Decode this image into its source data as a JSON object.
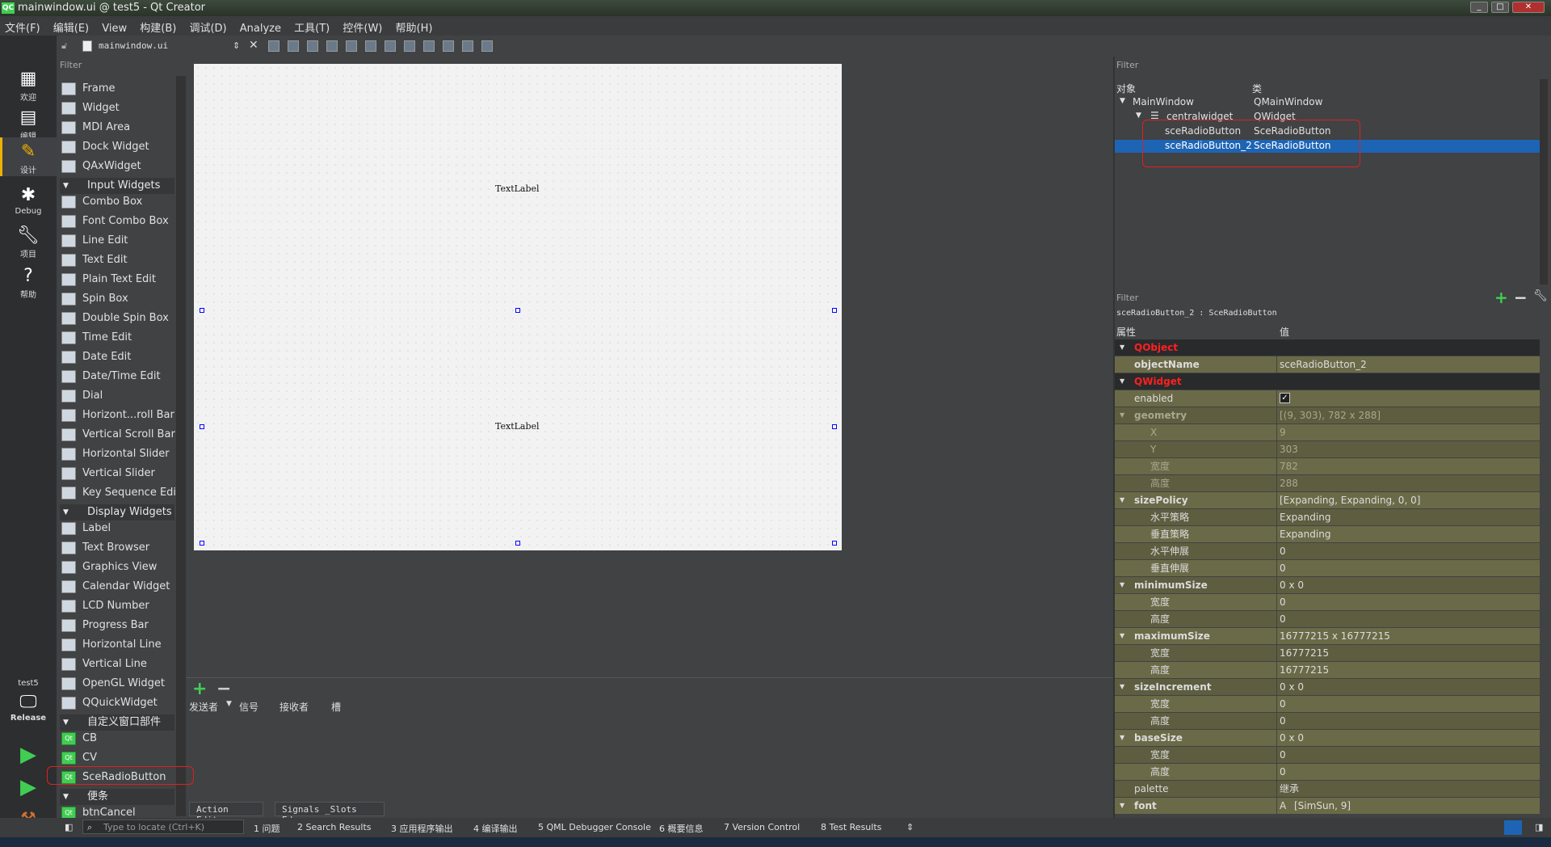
{
  "window": {
    "title": "mainwindow.ui @ test5 - Qt Creator",
    "app_badge": "QC"
  },
  "menubar": [
    "文件(F)",
    "编辑(E)",
    "View",
    "构建(B)",
    "调试(D)",
    "Analyze",
    "工具(T)",
    "控件(W)",
    "帮助(H)"
  ],
  "modes": [
    {
      "label": "欢迎",
      "icon": "grid-icon"
    },
    {
      "label": "编辑",
      "icon": "edit-doc-icon"
    },
    {
      "label": "设计",
      "icon": "pencil-icon"
    },
    {
      "label": "Debug",
      "icon": "bug-icon"
    },
    {
      "label": "项目",
      "icon": "wrench-icon"
    },
    {
      "label": "帮助",
      "icon": "help-icon"
    }
  ],
  "kit": {
    "project": "test5",
    "build": "Release"
  },
  "editor": {
    "file": "mainwindow.ui"
  },
  "widgetbox": {
    "filter": "Filter",
    "items": [
      {
        "type": "item",
        "label": "Frame"
      },
      {
        "type": "item",
        "label": "Widget"
      },
      {
        "type": "item",
        "label": "MDI Area"
      },
      {
        "type": "item",
        "label": "Dock Widget"
      },
      {
        "type": "item",
        "label": "QAxWidget"
      },
      {
        "type": "cat",
        "label": "Input Widgets"
      },
      {
        "type": "item",
        "label": "Combo Box"
      },
      {
        "type": "item",
        "label": "Font Combo Box"
      },
      {
        "type": "item",
        "label": "Line Edit"
      },
      {
        "type": "item",
        "label": "Text Edit"
      },
      {
        "type": "item",
        "label": "Plain Text Edit"
      },
      {
        "type": "item",
        "label": "Spin Box"
      },
      {
        "type": "item",
        "label": "Double Spin Box"
      },
      {
        "type": "item",
        "label": "Time Edit"
      },
      {
        "type": "item",
        "label": "Date Edit"
      },
      {
        "type": "item",
        "label": "Date/Time Edit"
      },
      {
        "type": "item",
        "label": "Dial"
      },
      {
        "type": "item",
        "label": "Horizont...roll Bar"
      },
      {
        "type": "item",
        "label": "Vertical Scroll Bar"
      },
      {
        "type": "item",
        "label": "Horizontal Slider"
      },
      {
        "type": "item",
        "label": "Vertical Slider"
      },
      {
        "type": "item",
        "label": "Key Sequence Edit"
      },
      {
        "type": "cat",
        "label": "Display Widgets"
      },
      {
        "type": "item",
        "label": "Label"
      },
      {
        "type": "item",
        "label": "Text Browser"
      },
      {
        "type": "item",
        "label": "Graphics View"
      },
      {
        "type": "item",
        "label": "Calendar Widget"
      },
      {
        "type": "item",
        "label": "LCD Number"
      },
      {
        "type": "item",
        "label": "Progress Bar"
      },
      {
        "type": "item",
        "label": "Horizontal Line"
      },
      {
        "type": "item",
        "label": "Vertical Line"
      },
      {
        "type": "item",
        "label": "OpenGL Widget"
      },
      {
        "type": "item",
        "label": "QQuickWidget"
      },
      {
        "type": "cat",
        "label": "自定义窗口部件"
      },
      {
        "type": "item",
        "label": "CB"
      },
      {
        "type": "item",
        "label": "CV"
      },
      {
        "type": "item",
        "label": "SceRadioButton"
      },
      {
        "type": "cat",
        "label": "便条"
      },
      {
        "type": "item",
        "label": "btnCancel"
      }
    ]
  },
  "canvas": {
    "label_top": "TextLabel",
    "label_bottom": "TextLabel"
  },
  "signals": {
    "headers": [
      "发送者",
      "信号",
      "接收者",
      "槽"
    ]
  },
  "bottom_tabs": [
    "Action Editor",
    "Signals _Slots Ed…"
  ],
  "object_inspector": {
    "filter": "Filter",
    "col_object": "对象",
    "col_class": "类",
    "rows": [
      {
        "name": "MainWindow",
        "cls": "QMainWindow"
      },
      {
        "name": "centralwidget",
        "cls": "QWidget"
      },
      {
        "name": "sceRadioButton",
        "cls": "SceRadioButton"
      },
      {
        "name": "sceRadioButton_2",
        "cls": "SceRadioButton"
      }
    ]
  },
  "property_editor": {
    "filter": "Filter",
    "object_line": "sceRadioButton_2 : SceRadioButton",
    "col_prop": "属性",
    "col_value": "值",
    "rows": [
      {
        "k": "QObject",
        "v": "",
        "style": "cat"
      },
      {
        "k": "objectName",
        "v": "sceRadioButton_2",
        "style": "olive-bold"
      },
      {
        "k": "QWidget",
        "v": "",
        "style": "cat"
      },
      {
        "k": "enabled",
        "v": "✓",
        "style": "olive"
      },
      {
        "k": "geometry",
        "v": "[(9, 303), 782 x 288]",
        "style": "olive-dim-bold"
      },
      {
        "k": "X",
        "v": "9",
        "style": "olive-dim-sub"
      },
      {
        "k": "Y",
        "v": "303",
        "style": "olive-dim-sub"
      },
      {
        "k": "宽度",
        "v": "782",
        "style": "olive-dim-sub"
      },
      {
        "k": "高度",
        "v": "288",
        "style": "olive-dim-sub"
      },
      {
        "k": "sizePolicy",
        "v": "[Expanding, Expanding, 0, 0]",
        "style": "olive-bold"
      },
      {
        "k": "水平策略",
        "v": "Expanding",
        "style": "olive-sub"
      },
      {
        "k": "垂直策略",
        "v": "Expanding",
        "style": "olive-sub"
      },
      {
        "k": "水平伸展",
        "v": "0",
        "style": "olive-sub"
      },
      {
        "k": "垂直伸展",
        "v": "0",
        "style": "olive-sub"
      },
      {
        "k": "minimumSize",
        "v": "0 x 0",
        "style": "olive-bold"
      },
      {
        "k": "宽度",
        "v": "0",
        "style": "olive-sub"
      },
      {
        "k": "高度",
        "v": "0",
        "style": "olive-sub"
      },
      {
        "k": "maximumSize",
        "v": "16777215 x 16777215",
        "style": "olive-bold-n"
      },
      {
        "k": "宽度",
        "v": "16777215",
        "style": "olive-sub"
      },
      {
        "k": "高度",
        "v": "16777215",
        "style": "olive-sub"
      },
      {
        "k": "sizeIncrement",
        "v": "0 x 0",
        "style": "olive-bold-n"
      },
      {
        "k": "宽度",
        "v": "0",
        "style": "olive-sub"
      },
      {
        "k": "高度",
        "v": "0",
        "style": "olive-sub"
      },
      {
        "k": "baseSize",
        "v": "0 x 0",
        "style": "olive-bold-n"
      },
      {
        "k": "宽度",
        "v": "0",
        "style": "olive-sub"
      },
      {
        "k": "高度",
        "v": "0",
        "style": "olive-sub"
      },
      {
        "k": "palette",
        "v": "继承",
        "style": "olive"
      },
      {
        "k": "font",
        "v": "[SimSun, 9]",
        "style": "olive-bold-n"
      }
    ]
  },
  "statusbar": {
    "locate": "Type to locate (Ctrl+K)",
    "panes": [
      "1 问题",
      "2 Search Results",
      "3 应用程序输出",
      "4 编译输出",
      "5 QML Debugger Console",
      "6 概要信息",
      "7 Version Control",
      "8 Test Results"
    ]
  },
  "colors": {
    "accent": "#41cd52",
    "selection": "#1e64b4",
    "highlight_box": "#e02020",
    "category_red": "#ff2020"
  }
}
